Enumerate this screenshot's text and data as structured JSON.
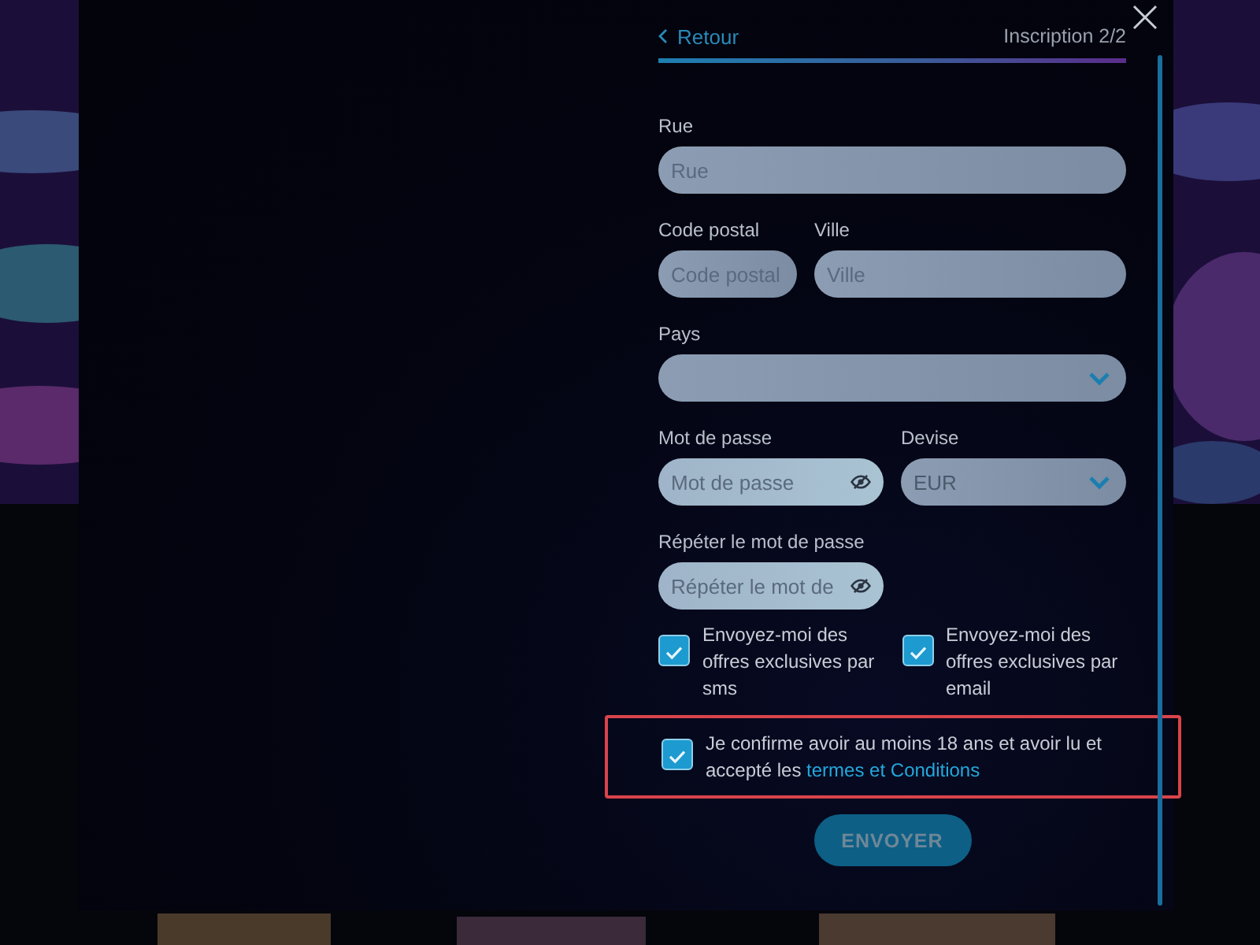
{
  "header": {
    "back": "Retour",
    "step": "Inscription 2/2",
    "level": 1
  },
  "rows": [
    [
      {
        "label": "Rue",
        "kind": "text",
        "placeholder": "Rue"
      }
    ],
    [
      {
        "label": "Code postal",
        "kind": "text",
        "placeholder": "Code postal"
      },
      {
        "label": "Ville",
        "kind": "text",
        "placeholder": "Ville"
      }
    ],
    [
      {
        "label": "Pays",
        "kind": "select"
      }
    ],
    [
      {
        "label": "Mot de passe",
        "kind": "password",
        "placeholder": "Mot de passe"
      },
      {
        "label": "Devise",
        "kind": "select",
        "value": "EUR"
      }
    ],
    [
      {
        "label": "Répéter le mot de passe",
        "kind": "password",
        "placeholder": "Répéter le mot de"
      }
    ]
  ],
  "options": [
    {
      "label": "Envoyez-moi des offres exclusives par sms",
      "checked": true
    },
    {
      "label": "Envoyez-moi des offres exclusives par email",
      "checked": true
    }
  ],
  "consent": {
    "text": "Je confirme avoir au moins 18 ans et avoir lu et accepté les ",
    "link": "termes et Conditions",
    "checked": true,
    "highlighted": true
  },
  "submit": "ENVOYER"
}
